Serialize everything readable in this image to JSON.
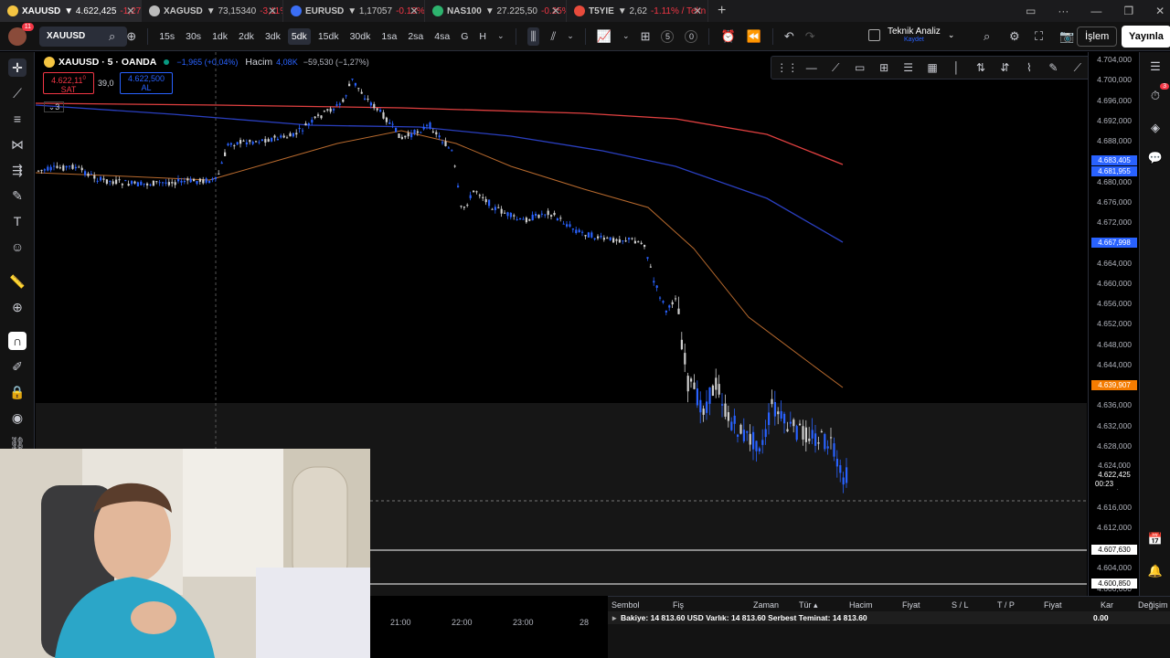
{
  "browser_tabs": [
    {
      "symbol": "XAUUSD",
      "price": "▼ 4.622,425",
      "change": "-1,27",
      "favicon": "#f5c542",
      "active": true
    },
    {
      "symbol": "XAGUSD",
      "price": "▼ 73,15340",
      "change": "-3,11%",
      "favicon": "#bbbbbb",
      "active": false
    },
    {
      "symbol": "EURUSD",
      "price": "▼ 1,17057",
      "change": "-0.13% /",
      "favicon": "#3b6ef5",
      "active": false
    },
    {
      "symbol": "NAS100",
      "price": "▼ 27.225,50",
      "change": "-0.25%",
      "favicon": "#2db36e",
      "active": false
    },
    {
      "symbol": "T5YIE",
      "price": "▼ 2,62",
      "change": "-1.11% / Tekn",
      "favicon": "#e84b3c",
      "active": false
    }
  ],
  "toolbar": {
    "avatar_badge": "11",
    "symbol": "XAUUSD",
    "timeframes": [
      "15s",
      "30s",
      "1dk",
      "2dk",
      "3dk",
      "5dk",
      "15dk",
      "30dk",
      "1sa",
      "2sa",
      "4sa",
      "G",
      "H"
    ],
    "active_timeframe": "5dk",
    "replay_speed": "5",
    "replay_count": "0",
    "layout_name": "Teknik Analiz",
    "layout_sub": "Kaydet",
    "trade_label": "İşlem",
    "publish_label": "Yayınla"
  },
  "legend": {
    "title": "XAUUSD · 5 · OANDA",
    "change": "−1,965 (+0,04%)",
    "volume_label": "Hacim",
    "volume_value": "4,08K",
    "volume_change": "−59,530 (−1,27%)",
    "sell_price": "4.622,11",
    "sell_sup": "0",
    "sell_label": "SAT",
    "spread": "39,0",
    "buy_price": "4.622,500",
    "buy_label": "AL",
    "indicators_count": "3"
  },
  "price_axis": {
    "ticks": [
      "4.704,000",
      "4.700,000",
      "4.696,000",
      "4.692,000",
      "4.688,000",
      "4.684,000",
      "4.680,000",
      "4.676,000",
      "4.672,000",
      "4.668,000",
      "4.664,000",
      "4.660,000",
      "4.656,000",
      "4.652,000",
      "4.648,000",
      "4.644,000",
      "4.640,000",
      "4.636,000",
      "4.632,000",
      "4.628,000",
      "4.624,000",
      "4.620,000",
      "4.616,000",
      "4.612,000",
      "4.608,000",
      "4.604,000",
      "4.600,000"
    ],
    "tags": [
      {
        "label": "4.683,405",
        "color": "#2962ff"
      },
      {
        "label": "4.681,955",
        "color": "#2962ff"
      },
      {
        "label": "4.667,998",
        "color": "#2962ff"
      },
      {
        "label": "4.639,907",
        "color": "#f57c00"
      },
      {
        "label": "4.624,000",
        "color": "#000000"
      },
      {
        "label": "4.622,425",
        "color": "#000000"
      },
      {
        "label": "00:23",
        "color": "#000000"
      },
      {
        "label": "4.607,630",
        "color": "#ffffff"
      },
      {
        "label": "4.600,850",
        "color": "#ffffff"
      }
    ]
  },
  "time_axis": {
    "ticks": [
      "21:00",
      "22:00",
      "23:00",
      "28"
    ]
  },
  "trade_panel": {
    "headers": [
      "Sembol",
      "Fiş",
      "Zaman",
      "Tür",
      "Hacim",
      "Fiyat",
      "S / L",
      "T / P",
      "Fiyat",
      "Kar",
      "Değişim"
    ],
    "balance": "Bakiye: 14 813.60 USD  Varlık: 14 813.60  Serbest Teminat: 14 813.60",
    "profit": "0.00"
  },
  "colors": {
    "bull": "#2962ff",
    "bear": "#cfcfcf",
    "ma_red": "#e04040",
    "ma_blue": "#2a3fbf",
    "ma_orange": "#b86a2e"
  },
  "icons": [
    "search-icon",
    "plus-icon",
    "candles-icon",
    "undo-icon",
    "redo-icon",
    "camera-icon",
    "settings-icon",
    "fullscreen-icon"
  ]
}
